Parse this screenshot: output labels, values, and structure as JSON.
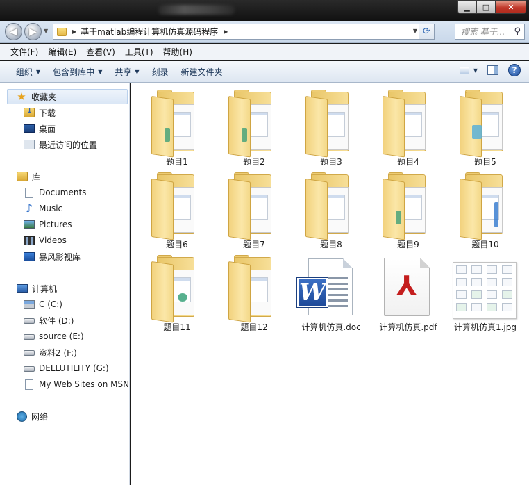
{
  "window": {
    "minimize_glyph": "▁",
    "maximize_glyph": "□",
    "close_glyph": "✕"
  },
  "nav": {
    "back_glyph": "◀",
    "forward_glyph": "▶",
    "address_path": "基于matlab编程计算机仿真源码程序",
    "address_separator": "▶",
    "search_placeholder": "搜索 基于..."
  },
  "menu": {
    "items": [
      "文件(F)",
      "编辑(E)",
      "查看(V)",
      "工具(T)",
      "帮助(H)"
    ]
  },
  "toolbar": {
    "organize": "组织",
    "include_library": "包含到库中",
    "share": "共享",
    "burn": "刻录",
    "new_folder": "新建文件夹",
    "help_glyph": "?"
  },
  "sidebar": {
    "favorites": {
      "label": "收藏夹",
      "items": [
        "下载",
        "桌面",
        "最近访问的位置"
      ]
    },
    "libraries": {
      "label": "库",
      "items": [
        "Documents",
        "Music",
        "Pictures",
        "Videos",
        "暴风影视库"
      ]
    },
    "computer": {
      "label": "计算机",
      "items": [
        "C (C:)",
        "软件 (D:)",
        "source (E:)",
        "资料2 (F:)",
        "DELLUTILITY (G:)",
        "My Web Sites on MSN"
      ]
    },
    "network": {
      "label": "网络"
    }
  },
  "files": [
    {
      "name": "题目1",
      "type": "folder"
    },
    {
      "name": "题目2",
      "type": "folder"
    },
    {
      "name": "题目3",
      "type": "folder"
    },
    {
      "name": "题目4",
      "type": "folder"
    },
    {
      "name": "题目5",
      "type": "folder"
    },
    {
      "name": "题目6",
      "type": "folder"
    },
    {
      "name": "题目7",
      "type": "folder"
    },
    {
      "name": "题目8",
      "type": "folder"
    },
    {
      "name": "题目9",
      "type": "folder"
    },
    {
      "name": "题目10",
      "type": "folder"
    },
    {
      "name": "题目11",
      "type": "folder"
    },
    {
      "name": "题目12",
      "type": "folder"
    },
    {
      "name": "计算机仿真.doc",
      "type": "word",
      "icon_letter": "W"
    },
    {
      "name": "计算机仿真.pdf",
      "type": "pdf",
      "icon_glyph": "⅄"
    },
    {
      "name": "计算机仿真1.jpg",
      "type": "image"
    }
  ]
}
